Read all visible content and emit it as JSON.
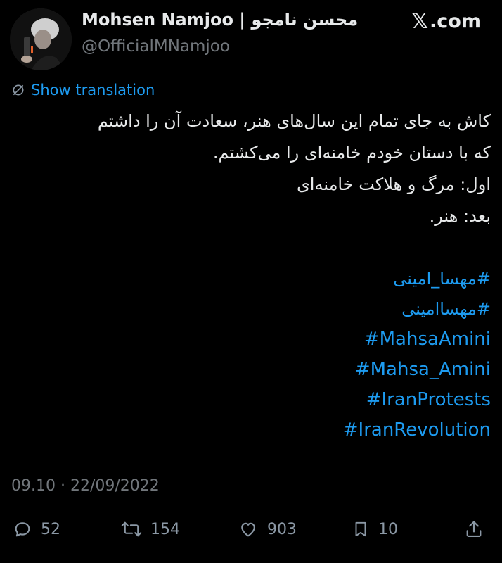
{
  "header": {
    "display_name": "Mohsen Namjoo | محسن نامجو",
    "handle": "@OfficialMNamjoo",
    "brand": "X.com",
    "brand_x": "𝕏",
    "brand_suffix": ".com"
  },
  "translate": {
    "label": "Show translation",
    "icon": "globe-icon"
  },
  "tweet": {
    "lines": [
      "کاش به جای تمام این سال‌های هنر، سعادت آن را داشتم",
      "که با دستان خودم خامنه‌ای را می‌کشتم.",
      "اول: مرگ و هلاکت خامنه‌ای",
      "بعد: هنر."
    ],
    "hashtags": [
      "#مهسا_امینی",
      "#مهساامینی",
      "#MahsaAmini",
      "#Mahsa_Amini",
      "#IranProtests",
      "#IranRevolution"
    ]
  },
  "meta": {
    "timestamp": "09.10 · 22/09/2022"
  },
  "actions": {
    "replies": "52",
    "retweets": "154",
    "likes": "903",
    "bookmarks": "10"
  },
  "colors": {
    "background": "#000000",
    "text": "#e7e9ea",
    "muted": "#71767b",
    "link": "#1d9bf0",
    "icon": "#8b98a5"
  }
}
